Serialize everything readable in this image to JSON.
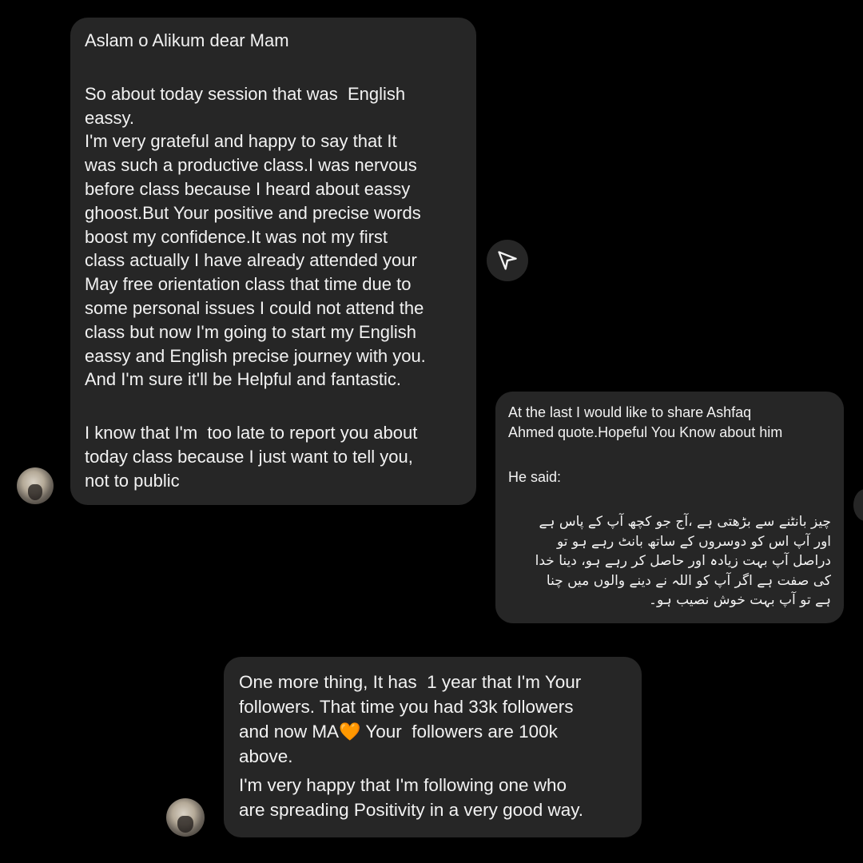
{
  "messages": [
    {
      "paragraphs": [
        "Aslam o Alikum dear Mam",
        "So about today session that was  English\neassy.\nI'm very grateful and happy to say that It\nwas such a productive class.I was nervous\nbefore class because I heard about eassy\nghoost.But Your positive and precise words\nboost my confidence.It was not my first\nclass actually I have already attended your\nMay free orientation class that time due to\nsome personal issues I could not attend the\nclass but now I'm going to start my English\neassy and English precise journey with you.\nAnd I'm sure it'll be Helpful and fantastic.",
        "I know that I'm  too late to report you about\ntoday class because I just want to tell you,\nnot to public"
      ]
    },
    {
      "paragraphs": [
        "At the last I would like to share Ashfaq\nAhmed quote.Hopeful You Know about him",
        "He said:",
        "چیز بانٹنے سے بڑھتی ہے ،آج جو کچھ آپ کے پاس ہے\nاور آپ اس کو دوسروں کے ساتھ بانٹ رہے ہو تو\nدراصل آپ بہت زیادہ اور حاصل کر رہے ہو، دینا خدا\nکی صفت ہے اگر آپ کو اللہ نے دینے والوں میں چنا\nہے تو آپ بہت خوش نصیب ہو۔"
      ]
    },
    {
      "line_1": "One more thing, It has  1 year that I'm Your\nfollowers. That time you had 33k followers\nand now MA",
      "heart_emoji": "🧡",
      "line_2": " Your  followers are 100k\nabove.",
      "line_3": "I'm very happy that I'm following one who\nare spreading Positivity in a very good way."
    }
  ],
  "icons": {
    "share": "paper-plane-icon",
    "avatar": "profile-avatar"
  },
  "colors": {
    "background": "#000000",
    "bubble": "#262626",
    "text": "#f2f2f2",
    "heart": "#f08a1c"
  }
}
